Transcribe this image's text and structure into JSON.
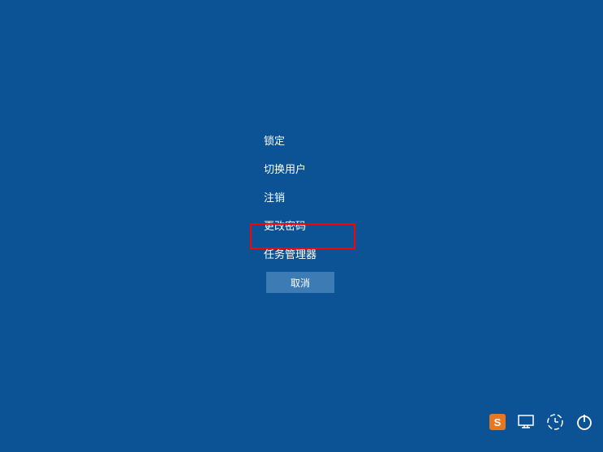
{
  "menu": {
    "items": [
      {
        "label": "锁定"
      },
      {
        "label": "切换用户"
      },
      {
        "label": "注销"
      },
      {
        "label": "更改密码"
      },
      {
        "label": "任务管理器"
      }
    ]
  },
  "cancel_button_label": "取消",
  "tray": {
    "sogou_label": "S"
  }
}
